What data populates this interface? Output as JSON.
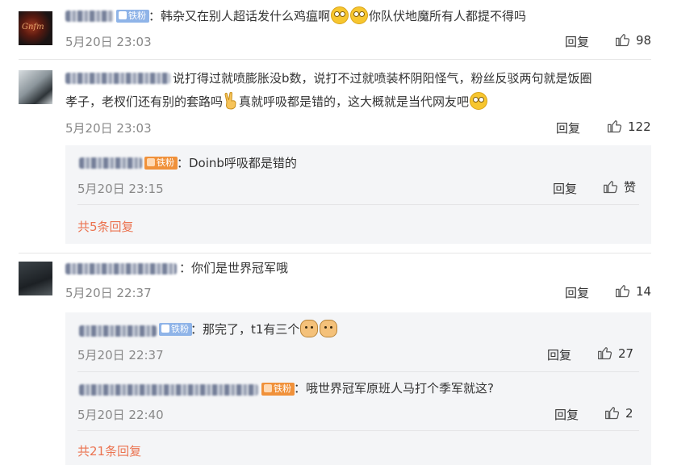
{
  "comments": [
    {
      "badge": "铁粉",
      "text": "韩杂又在别人超话发什么鸡瘟啊",
      "text_after": "你队伏地魔所有人都提不得吗",
      "time": "5月20日 23:03",
      "reply": "回复",
      "likes": "98",
      "emoji": "surprised-face"
    },
    {
      "text_line1": "说打得过就喷膨胀没b数，说打不过就喷装杯阴阳怪气，粉丝反驳两句就是饭圈",
      "text_line2a": "孝子，老杈们还有别的套路吗",
      "text_line2b": "真就呼吸都是错的，这大概就是当代网友吧",
      "time": "5月20日 23:03",
      "reply": "回复",
      "likes": "122",
      "sub": [
        {
          "badge": "铁粉",
          "text": "：Doinb呼吸都是错的",
          "time": "5月20日 23:15",
          "reply": "回复",
          "likes": "赞"
        }
      ],
      "more": "共5条回复"
    },
    {
      "text": "你们是世界冠军哦",
      "time": "5月20日 22:37",
      "reply": "回复",
      "likes": "14",
      "sub": [
        {
          "badge": "铁粉",
          "text": "：那完了，t1有三个",
          "time": "5月20日 22:37",
          "reply": "回复",
          "likes": "27",
          "emoji": "dog-face"
        },
        {
          "badge": "铁粉",
          "text": "：哦世界冠军原班人马打个季军就这?",
          "time": "5月20日 22:40",
          "reply": "回复",
          "likes": "2"
        }
      ],
      "more": "共21条回复"
    }
  ],
  "colors": {
    "more_link": "#eb7350",
    "timestamp": "#888888",
    "sub_background": "#f4f5f7",
    "badge_blue": "#8fb4e8",
    "badge_orange": "#f0913a"
  },
  "icons": [
    "thumbs-up-icon",
    "surprised-face-emoji",
    "peace-hand-emoji",
    "dog-face-emoji"
  ]
}
